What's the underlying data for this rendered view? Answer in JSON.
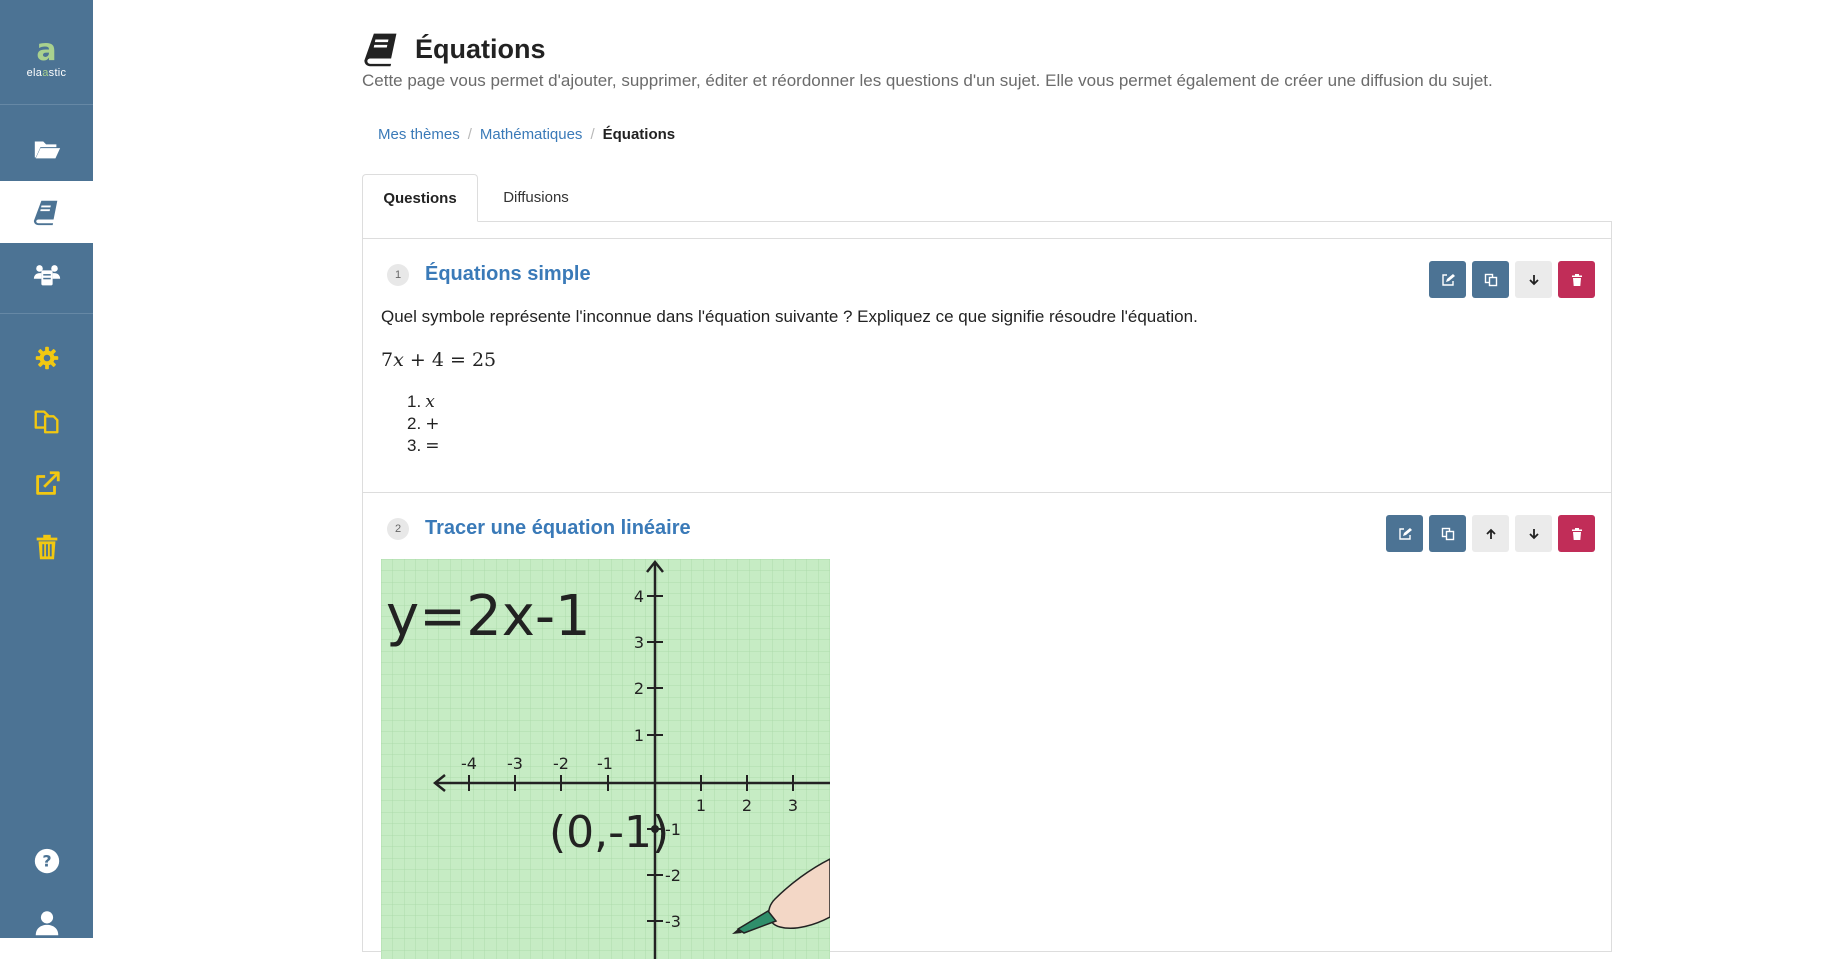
{
  "app": {
    "logo_letter": "a",
    "logo_text_1": "ela",
    "logo_text_2": "a",
    "logo_text_3": "stic"
  },
  "colors": {
    "sidebar": "#4c7394",
    "accent_yellow": "#f2c811",
    "link_blue": "#3a7ab8",
    "delete_red": "#c12d58"
  },
  "sidebar": {
    "items": [
      {
        "icon": "folder-open-icon",
        "active": false
      },
      {
        "icon": "book-icon",
        "active": true
      },
      {
        "icon": "users-book-icon",
        "active": false
      },
      {
        "icon": "gear-icon",
        "active": false
      },
      {
        "icon": "copy-icon",
        "active": false
      },
      {
        "icon": "external-link-icon",
        "active": false
      },
      {
        "icon": "trash-icon",
        "active": false
      },
      {
        "icon": "help-icon",
        "active": false
      },
      {
        "icon": "user-icon",
        "active": false
      }
    ]
  },
  "page": {
    "title": "Équations",
    "description": "Cette page vous permet d'ajouter, supprimer, éditer et réordonner les questions d'un sujet. Elle vous permet également de créer une diffusion du sujet."
  },
  "breadcrumb": {
    "items": [
      "Mes thèmes",
      "Mathématiques"
    ],
    "current": "Équations",
    "separator": "/"
  },
  "tabs": [
    {
      "label": "Questions",
      "active": true
    },
    {
      "label": "Diffusions",
      "active": false
    }
  ],
  "questions": [
    {
      "number": "1",
      "title": "Équations simple",
      "text": "Quel symbole représente l'inconnue dans l'équation suivante ? Expliquez ce que signifie résoudre l'équation.",
      "equation": {
        "a": "7",
        "var": "x",
        "op1": "+",
        "b": "4",
        "eq": "=",
        "c": "25"
      },
      "options": [
        {
          "n": "1.",
          "sym": "x"
        },
        {
          "n": "2.",
          "sym": "+"
        },
        {
          "n": "3.",
          "sym": "="
        }
      ],
      "actions": [
        "edit-icon",
        "copy-icon",
        "arrow-down-icon",
        "trash-icon"
      ]
    },
    {
      "number": "2",
      "title": "Tracer une équation linéaire",
      "actions": [
        "edit-icon",
        "copy-icon",
        "arrow-up-icon",
        "arrow-down-icon",
        "trash-icon"
      ],
      "image": {
        "equation_label": "y=2x-1",
        "point_label": "(0,-1)",
        "x_ticks": [
          "-4",
          "-3",
          "-2",
          "-1",
          "1",
          "2",
          "3"
        ],
        "y_ticks": [
          "4",
          "3",
          "2",
          "1",
          "-1",
          "-2",
          "-3"
        ],
        "background": "#c6ecc4"
      }
    }
  ]
}
